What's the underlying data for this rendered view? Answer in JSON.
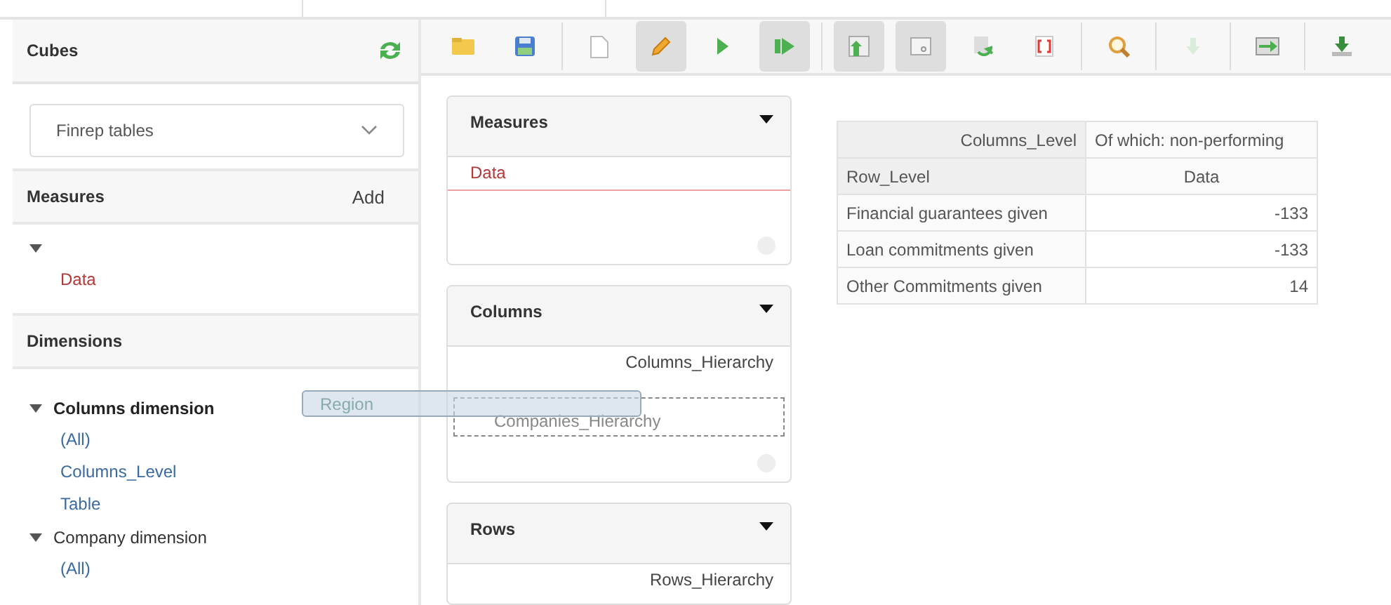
{
  "sidebar": {
    "title": "Cubes",
    "cube_select": {
      "value": "Finrep tables"
    },
    "measures": {
      "title": "Measures",
      "action": "Add",
      "expanded": true,
      "items": [
        "Data"
      ]
    },
    "dimensions": {
      "title": "Dimensions",
      "items": [
        {
          "label": "Columns dimension",
          "expanded": true,
          "selected": true,
          "children": [
            "(All)",
            "Columns_Level",
            "Table"
          ]
        },
        {
          "label": "Company dimension",
          "expanded": true,
          "selected": false,
          "children": [
            "(All)"
          ]
        }
      ]
    }
  },
  "toolbar": [
    {
      "kind": "folder",
      "pressed": false
    },
    {
      "kind": "save",
      "pressed": false
    },
    {
      "kind": "separator"
    },
    {
      "kind": "new",
      "pressed": false
    },
    {
      "kind": "edit",
      "pressed": true
    },
    {
      "kind": "run",
      "pressed": false
    },
    {
      "kind": "run-step",
      "pressed": true
    },
    {
      "kind": "separator"
    },
    {
      "kind": "table-up",
      "pressed": true
    },
    {
      "kind": "window",
      "pressed": true
    },
    {
      "kind": "refresh",
      "pressed": false
    },
    {
      "kind": "brackets",
      "pressed": false
    },
    {
      "kind": "separator"
    },
    {
      "kind": "search",
      "pressed": false
    },
    {
      "kind": "separator"
    },
    {
      "kind": "down",
      "pressed": false,
      "disabled": true
    },
    {
      "kind": "separator"
    },
    {
      "kind": "table-arrow",
      "pressed": false
    },
    {
      "kind": "separator"
    },
    {
      "kind": "download",
      "pressed": false
    }
  ],
  "cards": [
    {
      "title": "Measures",
      "footer": true,
      "items": [
        {
          "kind": "measure",
          "label": "Data"
        }
      ]
    },
    {
      "title": "Columns",
      "footer": true,
      "items": [
        {
          "kind": "hierarchy",
          "label": "Columns_Hierarchy"
        },
        {
          "kind": "drop-target",
          "label": "Companies_Hierarchy"
        }
      ]
    },
    {
      "title": "Rows",
      "footer": false,
      "items": [
        {
          "kind": "hierarchy",
          "label": "Rows_Hierarchy"
        }
      ]
    }
  ],
  "drag_ghost": {
    "label": "Region"
  },
  "table": {
    "header": [
      [
        "Columns_Level",
        "Of which: non-performing"
      ],
      [
        "Row_Level",
        "Data"
      ]
    ],
    "rows": [
      [
        "Financial guarantees given",
        "-133"
      ],
      [
        "Loan commitments given",
        "-133"
      ],
      [
        "Other Commitments given",
        "14"
      ]
    ]
  }
}
